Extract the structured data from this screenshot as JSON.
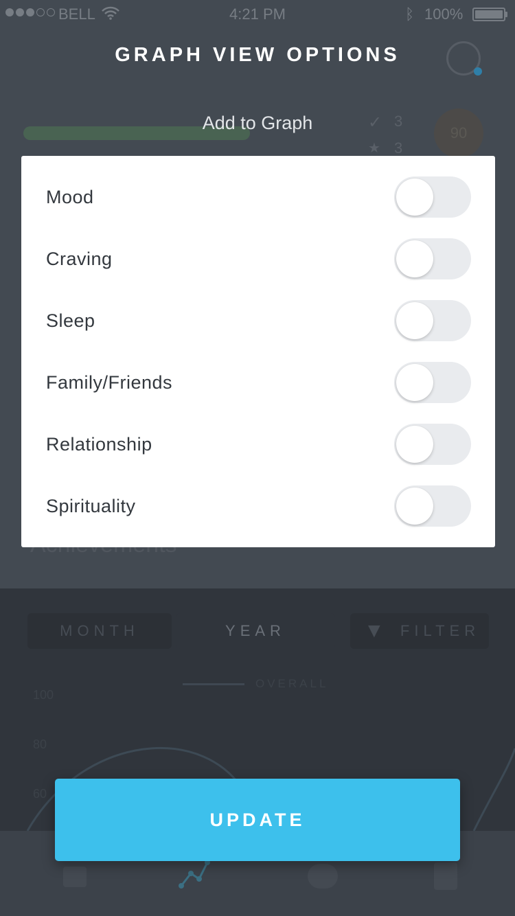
{
  "status_bar": {
    "carrier": "BELL",
    "time": "4:21 PM",
    "battery": "100%",
    "signal_bars_filled": 3,
    "signal_bars_total": 5
  },
  "background": {
    "section_heading": "Achievements",
    "stat_1": "3",
    "stat_2": "3",
    "score": "90",
    "range_tabs": [
      "MONTH",
      "YEAR"
    ],
    "filter_label": "FILTER",
    "legend_label": "OVERALL",
    "y_ticks": [
      "100",
      "80",
      "60"
    ]
  },
  "modal": {
    "title": "GRAPH VIEW OPTIONS",
    "subtitle": "Add to Graph",
    "options": [
      {
        "label": "Mood",
        "enabled": false
      },
      {
        "label": "Craving",
        "enabled": false
      },
      {
        "label": "Sleep",
        "enabled": false
      },
      {
        "label": "Family/Friends",
        "enabled": false
      },
      {
        "label": "Relationship",
        "enabled": false
      },
      {
        "label": "Spirituality",
        "enabled": false
      }
    ],
    "update_label": "UPDATE"
  },
  "colors": {
    "accent": "#3dc0ec",
    "overlay_dark": "#434a52",
    "toggle_off": "#e9ebee"
  }
}
